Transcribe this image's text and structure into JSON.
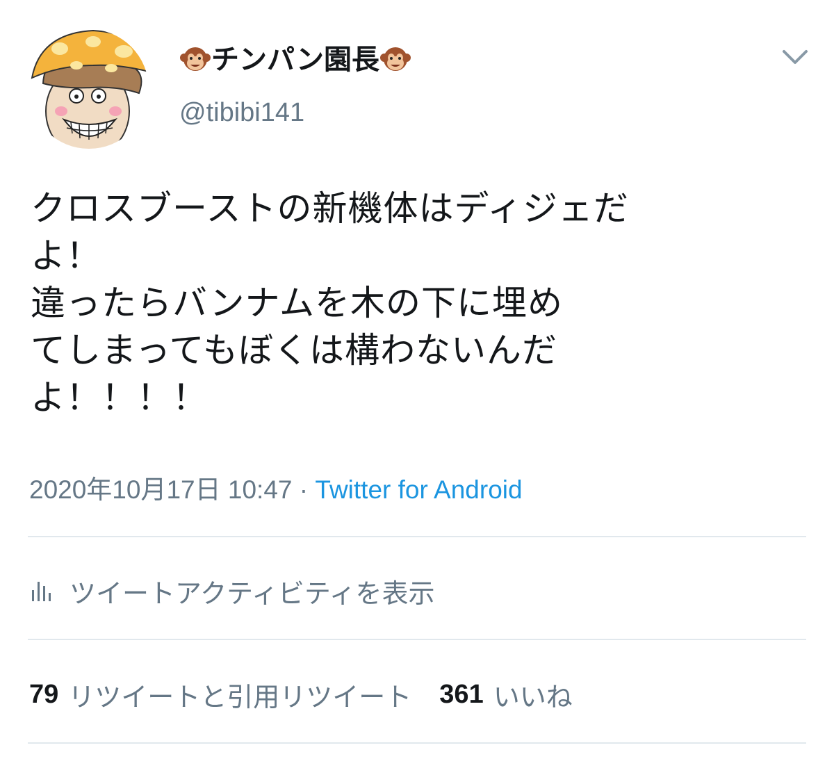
{
  "author": {
    "display_name": "チンパン園長",
    "handle": "@tibibi141",
    "name_prefix_icon": "monkey-face-icon",
    "name_suffix_icon": "monkey-face-icon"
  },
  "tweet": {
    "lines": [
      "クロスブーストの新機体はディジェだ",
      "よ！",
      "違ったらバンナムを木の下に埋め",
      "てしまってもぼくは構わないんだ",
      "よ！！！！"
    ],
    "timestamp": "2020年10月17日 10:47",
    "separator": " · ",
    "source": "Twitter for Android"
  },
  "activity": {
    "label": "ツイートアクティビティを表示",
    "icon": "bar-chart-icon"
  },
  "stats": {
    "retweets_count": "79",
    "retweets_label": "リツイートと引用リツイート",
    "likes_count": "361",
    "likes_label": "いいね"
  },
  "colors": {
    "text": "#14171a",
    "secondary": "#657786",
    "link": "#1b95e0",
    "divider": "#e1e8ed"
  }
}
